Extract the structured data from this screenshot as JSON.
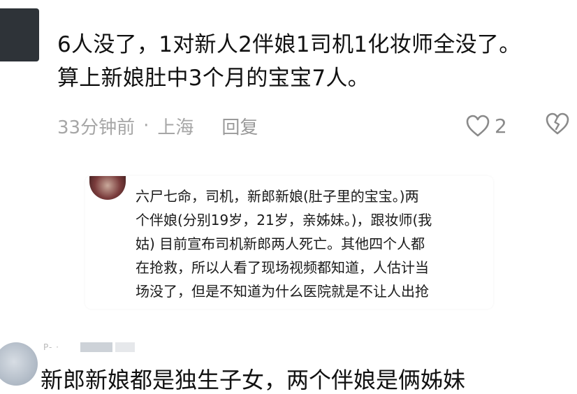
{
  "top_comment": {
    "text_lines": [
      "6人没了，1对新人2伴娘1司机1化妆师全没了。",
      "算上新娘肚中3个月的宝宝7人。"
    ],
    "time": "33分钟前",
    "separator": "·",
    "location": "上海",
    "reply_label": "回复",
    "like_count": "2"
  },
  "embedded_screenshot": {
    "text_lines": [
      "六尸七命，司机，新郎新娘(肚子里的宝宝。)两",
      "个伴娘(分别19岁，21岁，亲姊妹。)，跟妆师(我",
      "姑) 目前宣布司机新郎两人死亡。其他四个人都",
      "在抢救，所以人看了现场视频都知道，人估计当",
      "场没了，但是不知道为什么医院就是不让人出抢"
    ]
  },
  "bottom_comment": {
    "username_fragment": "P- ·",
    "text": "新郎新娘都是独生子女，两个伴娘是俩姊妹"
  },
  "icons": {
    "like": "heart-outline-icon",
    "dislike": "broken-heart-icon"
  }
}
